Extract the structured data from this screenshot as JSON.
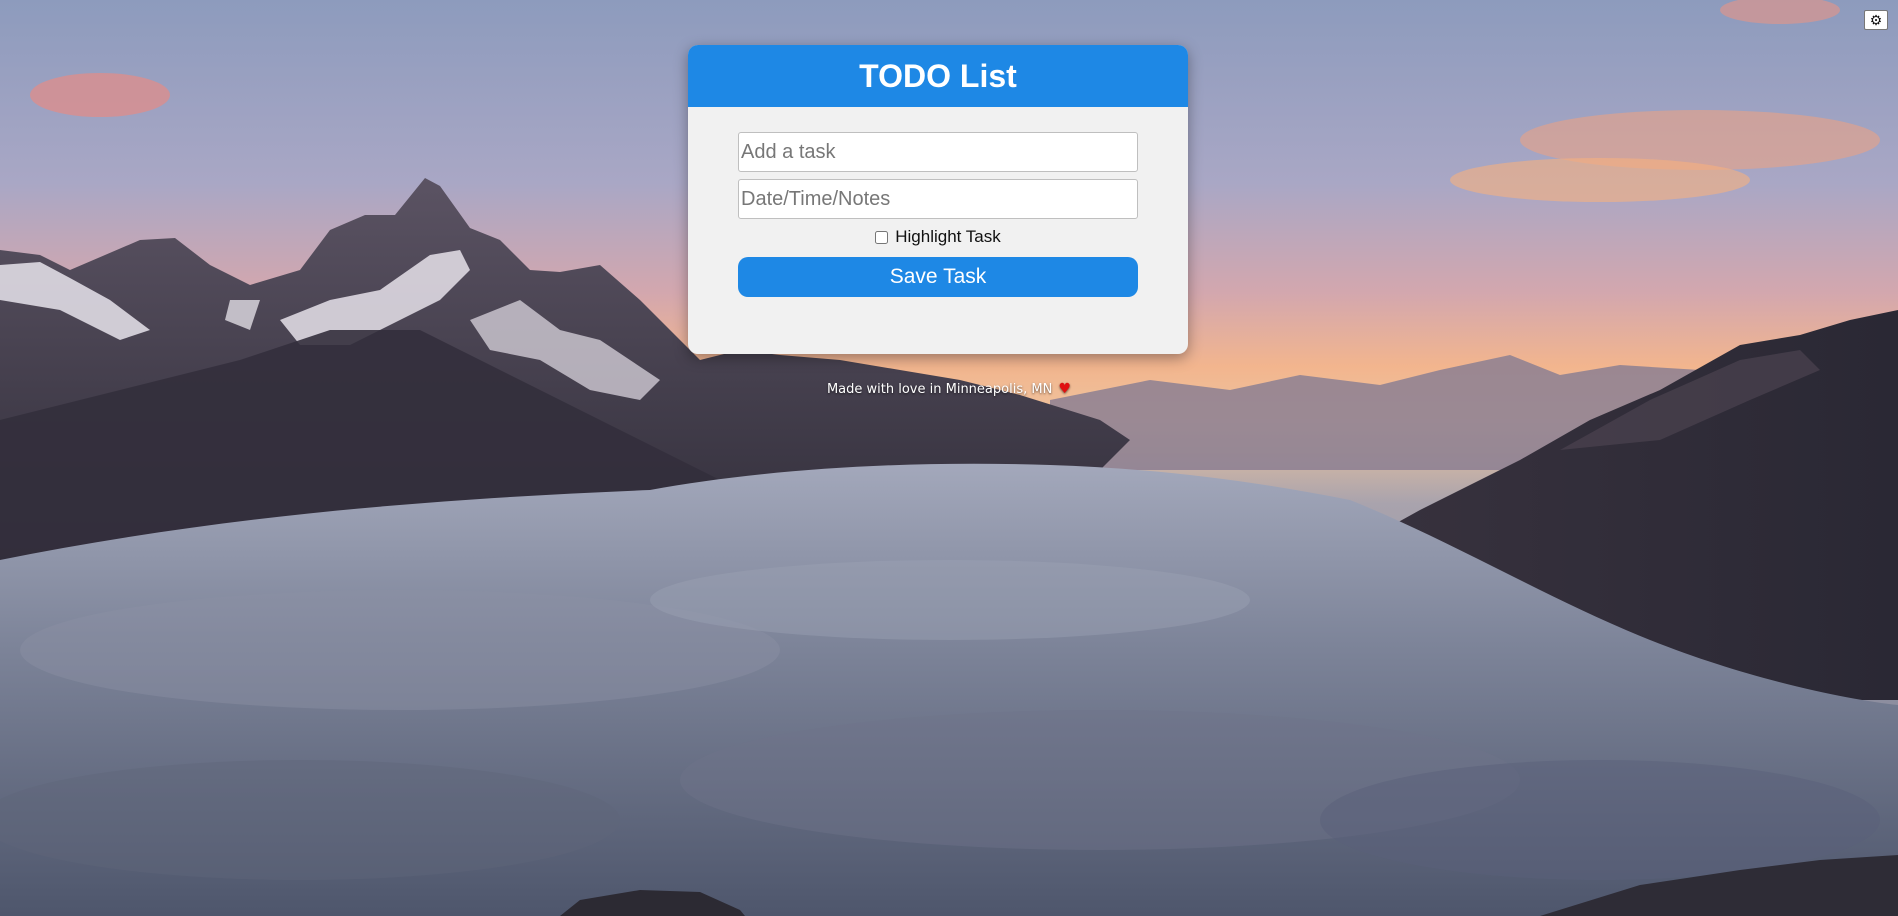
{
  "settings": {
    "icon": "gear-icon",
    "glyph": "⚙"
  },
  "app": {
    "title": "TODO List"
  },
  "form": {
    "task_placeholder": "Add a task",
    "notes_placeholder": "Date/Time/Notes",
    "highlight_label": "Highlight Task",
    "highlight_checked": false,
    "save_label": "Save Task"
  },
  "footer": {
    "text": "Made with love in Minneapolis, MN",
    "heart_icon": "heart-icon",
    "heart_glyph": "♥"
  },
  "colors": {
    "accent": "#1e88e5",
    "card_bg": "#f1f1f1",
    "heart": "#e01010"
  }
}
